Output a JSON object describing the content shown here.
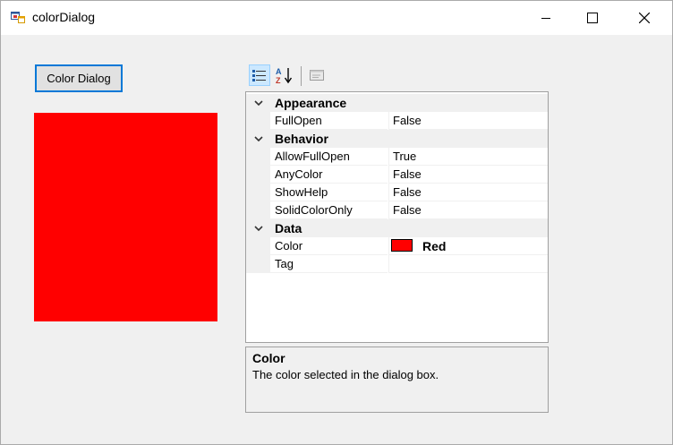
{
  "window": {
    "title": "colorDialog",
    "title_icon": "winforms-app-icon",
    "controls": [
      "minimize-icon",
      "maximize-icon",
      "close-icon"
    ]
  },
  "color_button": {
    "label": "Color Dialog"
  },
  "selected_color": "#ff0000",
  "toolbar": {
    "items": [
      "categorized-icon",
      "alphabetical-icon",
      "property-pages-icon"
    ],
    "active": "categorized-icon"
  },
  "property_grid": {
    "categories": [
      {
        "name": "Appearance",
        "props": [
          {
            "name": "FullOpen",
            "value": "False"
          }
        ]
      },
      {
        "name": "Behavior",
        "props": [
          {
            "name": "AllowFullOpen",
            "value": "True"
          },
          {
            "name": "AnyColor",
            "value": "False"
          },
          {
            "name": "ShowHelp",
            "value": "False"
          },
          {
            "name": "SolidColorOnly",
            "value": "False"
          }
        ]
      },
      {
        "name": "Data",
        "props": [
          {
            "name": "Color",
            "value": "Red",
            "swatch": "#ff0000"
          },
          {
            "name": "Tag",
            "value": ""
          }
        ]
      }
    ]
  },
  "help": {
    "title": "Color",
    "description": "The color selected in the dialog box."
  },
  "colors": {
    "accent": "#0078d7",
    "window_bg": "#f0f0f0",
    "selection_bg": "#cce8ff"
  }
}
